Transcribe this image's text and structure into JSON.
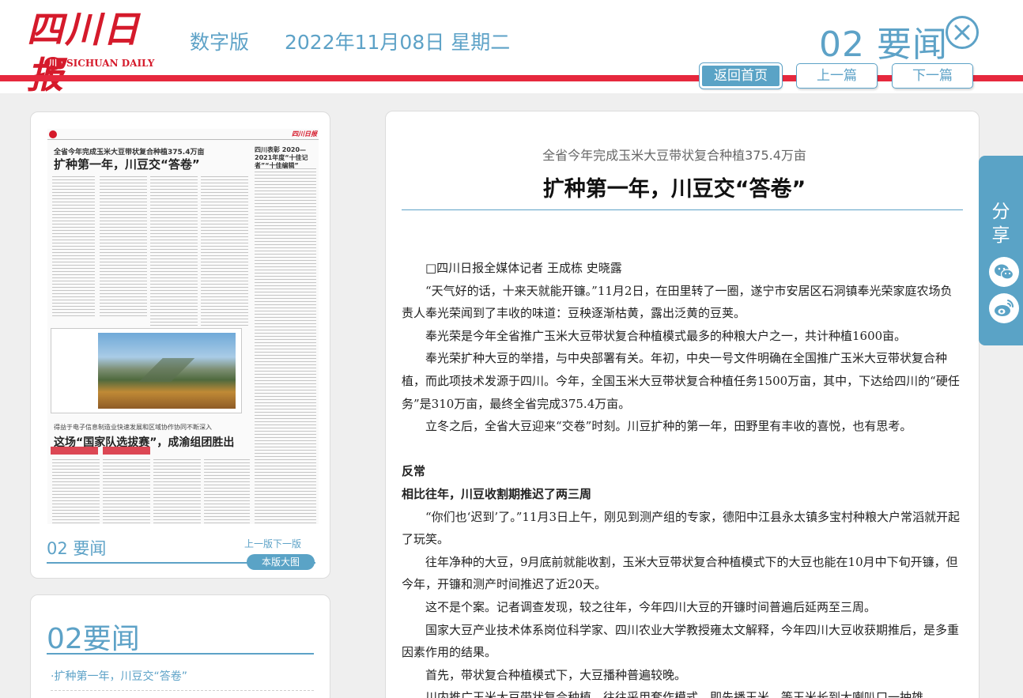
{
  "header": {
    "logo_cn": "四川日报",
    "logo_en": "SICHUAN DAILY",
    "logo_seal": "川",
    "edition": "数字版",
    "date": "2022年11月08日 星期二",
    "page_title": "02 要闻"
  },
  "nav": {
    "home": "返回首页",
    "prev": "上一篇",
    "next": "下一篇"
  },
  "thumbnail": {
    "paper_sub": "全省今年完成玉米大豆带状复合种植375.4万亩",
    "paper_title": "扩种第一年，川豆交“答卷”",
    "paper_side": "四川表彰 2020—2021年度“十佳记者”“十佳编辑”",
    "paper_sub2": "得益于电子信息制造业快速发展和区域协作协同不断深入",
    "paper_title2": "这场“国家队选拔赛”，成渝组团胜出",
    "page_label": "02 要闻",
    "prev_next": "上一版下一版",
    "big_image": "本版大图"
  },
  "list": {
    "title": "02要闻",
    "items": [
      "·扩种第一年，川豆交“答卷”"
    ]
  },
  "article": {
    "subtitle": "全省今年完成玉米大豆带状复合种植375.4万亩",
    "title": "扩种第一年，川豆交“答卷”",
    "paragraphs": [
      "□四川日报全媒体记者  王成栋 史晓露",
      "“天气好的话，十来天就能开镰。”11月2日，在田里转了一圈，遂宁市安居区石洞镇奉光荣家庭农场负责人奉光荣闻到了丰收的味道：豆秧逐渐枯黄，露出泛黄的豆荚。",
      "奉光荣是今年全省推广玉米大豆带状复合种植模式最多的种粮大户之一，共计种植1600亩。",
      "奉光荣扩种大豆的举措，与中央部署有关。年初，中央一号文件明确在全国推广玉米大豆带状复合种植，而此项技术发源于四川。今年，全国玉米大豆带状复合种植任务1500万亩，其中，下达给四川的“硬任务”是310万亩，最终全省完成375.4万亩。",
      "立冬之后，全省大豆迎来“交卷”时刻。川豆扩种的第一年，田野里有丰收的喜悦，也有思考。"
    ],
    "section_head": "反常",
    "section_sub": "相比往年，川豆收割期推迟了两三周",
    "paragraphs2": [
      "“你们也‘迟到’了。”11月3日上午，刚见到测产组的专家，德阳中江县永太镇多宝村种粮大户常滔就开起了玩笑。",
      "往年净种的大豆，9月底前就能收割，玉米大豆带状复合种植模式下的大豆也能在10月中下旬开镰，但今年，开镰和测产时间推迟了近20天。",
      "这不是个案。记者调查发现，较之往年，今年四川大豆的开镰时间普遍后延两至三周。",
      "国家大豆产业技术体系岗位科学家、四川农业大学教授雍太文解释，今年四川大豆收获期推后，是多重因素作用的结果。",
      "首先，带状复合种植模式下，大豆播种普遍较晚。",
      "川内推广玉米大豆带状复合种植，往往采用套作模式，即先播玉米，等玉米长到大喇叭口一抽雄"
    ]
  },
  "share": {
    "label": "分享",
    "icons": [
      "wechat-icon",
      "weibo-icon"
    ]
  },
  "colors": {
    "accent": "#5da2c7",
    "brand_red": "#e6283d",
    "background": "#efefef"
  }
}
